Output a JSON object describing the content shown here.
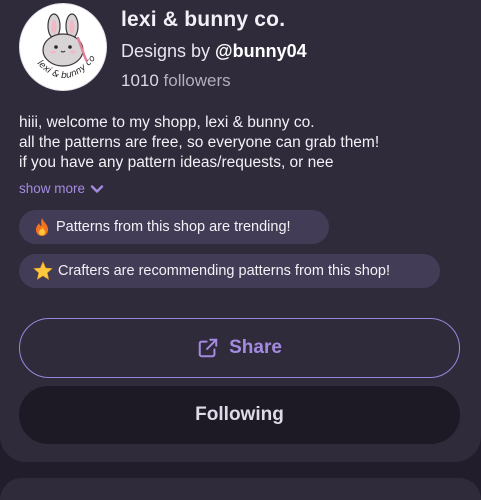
{
  "profile": {
    "shop_name": "lexi & bunny co.",
    "designs_by_prefix": "Designs by ",
    "designer_handle": "@bunny04",
    "follower_count": "1010",
    "followers_label": " followers",
    "avatar_text": "lexi & bunny co."
  },
  "bio": {
    "lines": [
      "hiii, welcome to my shopp, lexi & bunny co.",
      "all the patterns are free, so everyone can grab them!",
      "if you have any pattern ideas/requests, or nee"
    ],
    "show_more_label": "show more"
  },
  "badges": [
    {
      "icon": "fire-icon",
      "label": "Patterns from this shop are trending!"
    },
    {
      "icon": "star-icon",
      "label": "Crafters are recommending patterns from this shop!"
    }
  ],
  "actions": {
    "share_label": "Share",
    "following_label": "Following"
  },
  "colors": {
    "accent": "#a48be0",
    "card_bg": "#2f2b3b",
    "page_bg": "#211d2b",
    "pill_bg": "#433c57"
  }
}
